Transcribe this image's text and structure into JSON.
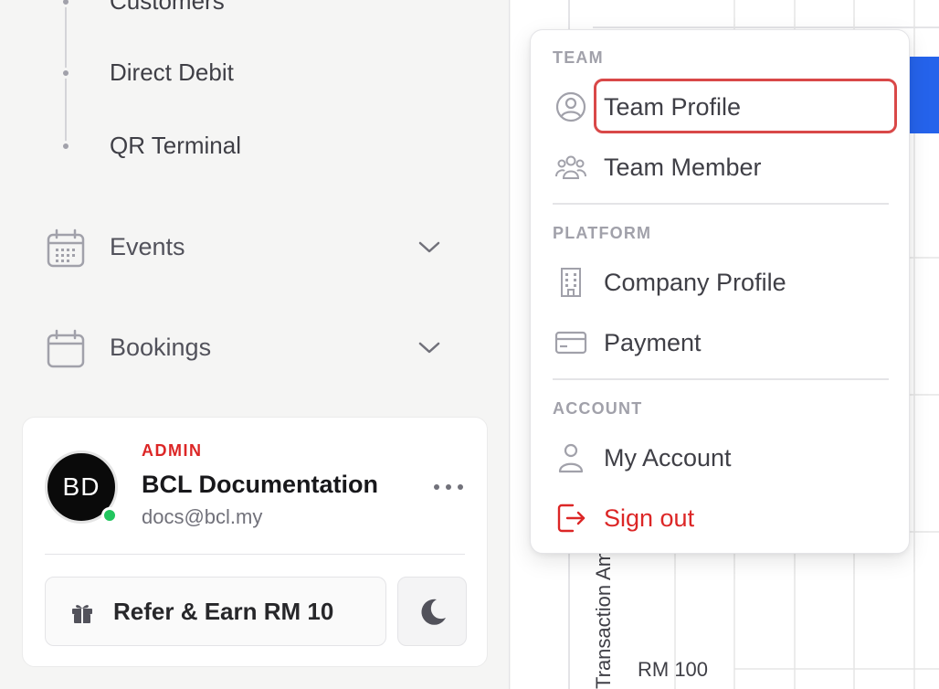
{
  "sidebar": {
    "subnav": [
      {
        "label": "Customers"
      },
      {
        "label": "Direct Debit"
      },
      {
        "label": "QR Terminal"
      }
    ],
    "nav": [
      {
        "label": "Events",
        "icon": "calendar-grid-icon"
      },
      {
        "label": "Bookings",
        "icon": "calendar-icon"
      }
    ],
    "user": {
      "initials": "BD",
      "role": "ADMIN",
      "name": "BCL Documentation",
      "email": "docs@bcl.my",
      "status": "online"
    },
    "refer_label": "Refer & Earn RM 10",
    "theme_icon": "moon-icon"
  },
  "chart": {
    "y_axis_title": "Transaction Amount",
    "y_tick": "RM 100"
  },
  "menu": {
    "sections": [
      {
        "title": "TEAM",
        "items": [
          {
            "label": "Team Profile",
            "icon": "user-circle-icon",
            "highlighted": true
          },
          {
            "label": "Team Member",
            "icon": "users-group-icon"
          }
        ]
      },
      {
        "title": "PLATFORM",
        "items": [
          {
            "label": "Company Profile",
            "icon": "building-icon"
          },
          {
            "label": "Payment",
            "icon": "credit-card-icon"
          }
        ]
      },
      {
        "title": "ACCOUNT",
        "items": [
          {
            "label": "My Account",
            "icon": "user-icon"
          },
          {
            "label": "Sign out",
            "icon": "sign-out-icon",
            "danger": true
          }
        ]
      }
    ]
  },
  "colors": {
    "accent": "#2563eb",
    "danger": "#dc2626",
    "online": "#22c55e",
    "highlight": "#d94848"
  }
}
